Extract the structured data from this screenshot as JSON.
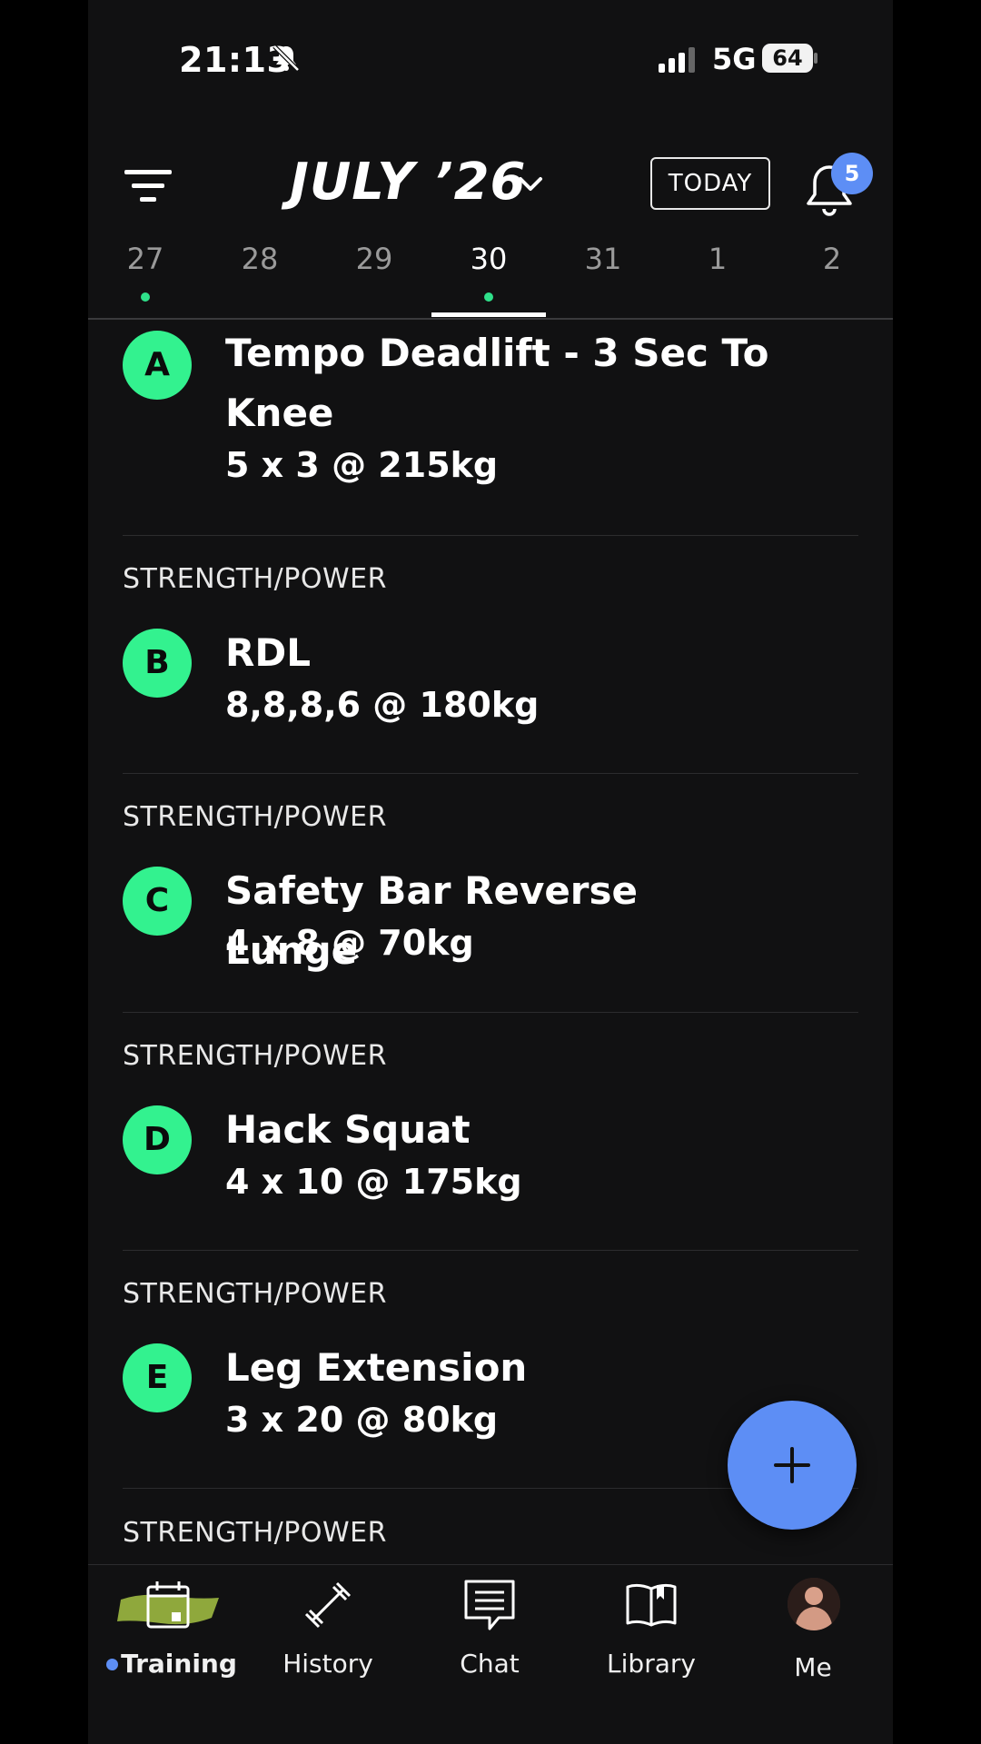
{
  "status_bar": {
    "time": "21:13",
    "network": "5G",
    "battery": "64"
  },
  "header": {
    "month": "JULY ’26",
    "today_label": "TODAY",
    "notification_count": "5"
  },
  "dates": [
    {
      "day": "27",
      "has_workout": true,
      "active": false
    },
    {
      "day": "28",
      "has_workout": false,
      "active": false
    },
    {
      "day": "29",
      "has_workout": false,
      "active": false
    },
    {
      "day": "30",
      "has_workout": true,
      "active": true
    },
    {
      "day": "31",
      "has_workout": false,
      "active": false
    },
    {
      "day": "1",
      "has_workout": false,
      "active": false
    },
    {
      "day": "2",
      "has_workout": false,
      "active": false
    }
  ],
  "exercises": [
    {
      "letter": "A",
      "category": "",
      "name": "Tempo Deadlift - 3 Sec To Knee",
      "sets": "5 x 3 @ 215kg"
    },
    {
      "letter": "B",
      "category": "STRENGTH/POWER",
      "name": "RDL",
      "sets": "8,8,8,6 @ 180kg"
    },
    {
      "letter": "C",
      "category": "STRENGTH/POWER",
      "name": "Safety Bar Reverse Lunge",
      "sets": "4 x 8 @ 70kg"
    },
    {
      "letter": "D",
      "category": "STRENGTH/POWER",
      "name": "Hack Squat",
      "sets": "4 x 10 @ 175kg"
    },
    {
      "letter": "E",
      "category": "STRENGTH/POWER",
      "name": "Leg Extension",
      "sets": "3 x 20 @ 80kg"
    },
    {
      "letter": "",
      "category": "STRENGTH/POWER",
      "name": "",
      "sets": ""
    }
  ],
  "nav": {
    "tabs": [
      {
        "label": "Training",
        "icon": "calendar-icon",
        "active": true
      },
      {
        "label": "History",
        "icon": "barbell-icon",
        "active": false
      },
      {
        "label": "Chat",
        "icon": "chat-icon",
        "active": false
      },
      {
        "label": "Library",
        "icon": "book-icon",
        "active": false
      },
      {
        "label": "Me",
        "icon": "avatar",
        "active": false
      }
    ]
  },
  "colors": {
    "accent_green": "#33f28f",
    "accent_blue": "#5d8ef5",
    "background": "#111112"
  }
}
